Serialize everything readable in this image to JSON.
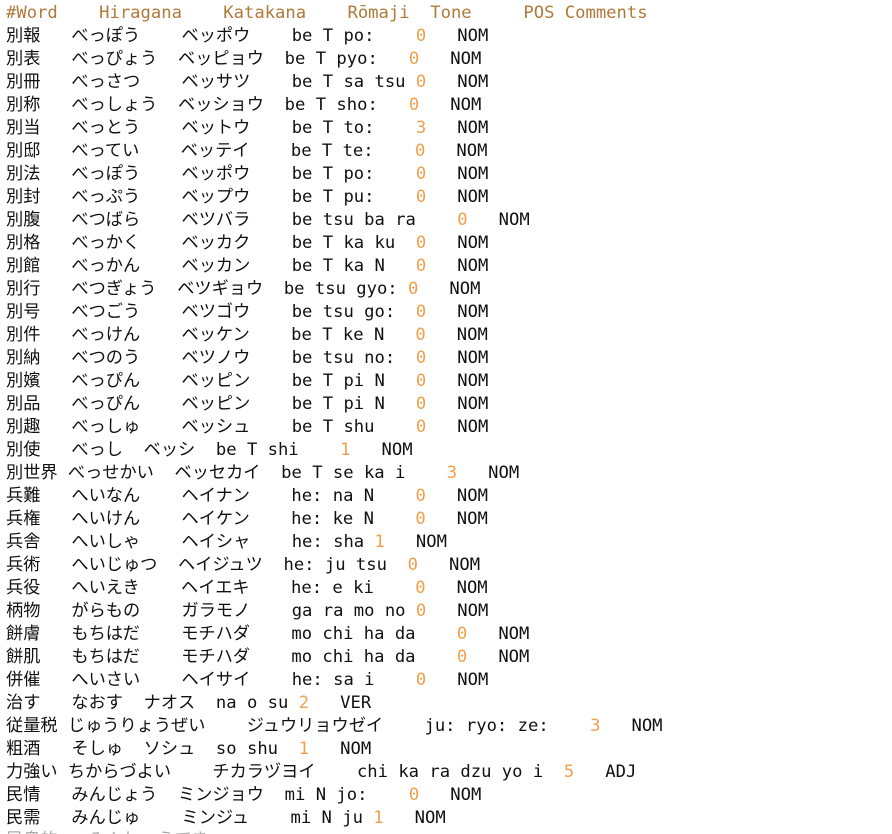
{
  "header": "#Word    Hiragana    Katakana    Rōmaji  Tone     POS Comments",
  "colors": {
    "text": "#111111",
    "header": "#b07a3a",
    "tone": "#f0a04a"
  },
  "rows": [
    {
      "pre": "別報   べっぽう    ベッポウ    be T po:    ",
      "tone": "0",
      "post": "   NOM"
    },
    {
      "pre": "別表   べっぴょう  ベッピョウ  be T pyo:   ",
      "tone": "0",
      "post": "   NOM"
    },
    {
      "pre": "別冊   べっさつ    ベッサツ    be T sa tsu ",
      "tone": "0",
      "post": "   NOM"
    },
    {
      "pre": "別称   べっしょう  ベッショウ  be T sho:   ",
      "tone": "0",
      "post": "   NOM"
    },
    {
      "pre": "別当   べっとう    ベットウ    be T to:    ",
      "tone": "3",
      "post": "   NOM"
    },
    {
      "pre": "別邸   べってい    ベッテイ    be T te:    ",
      "tone": "0",
      "post": "   NOM"
    },
    {
      "pre": "別法   べっぽう    ベッポウ    be T po:    ",
      "tone": "0",
      "post": "   NOM"
    },
    {
      "pre": "別封   べっぷう    ベップウ    be T pu:    ",
      "tone": "0",
      "post": "   NOM"
    },
    {
      "pre": "別腹   べつばら    ベツバラ    be tsu ba ra    ",
      "tone": "0",
      "post": "   NOM"
    },
    {
      "pre": "別格   べっかく    ベッカク    be T ka ku  ",
      "tone": "0",
      "post": "   NOM"
    },
    {
      "pre": "別館   べっかん    ベッカン    be T ka N   ",
      "tone": "0",
      "post": "   NOM"
    },
    {
      "pre": "別行   べつぎょう  ベツギョウ  be tsu gyo: ",
      "tone": "0",
      "post": "   NOM"
    },
    {
      "pre": "別号   べつごう    ベツゴウ    be tsu go:  ",
      "tone": "0",
      "post": "   NOM"
    },
    {
      "pre": "別件   べっけん    ベッケン    be T ke N   ",
      "tone": "0",
      "post": "   NOM"
    },
    {
      "pre": "別納   べつのう    ベツノウ    be tsu no:  ",
      "tone": "0",
      "post": "   NOM"
    },
    {
      "pre": "別嬪   べっぴん    ベッピン    be T pi N   ",
      "tone": "0",
      "post": "   NOM"
    },
    {
      "pre": "別品   べっぴん    ベッピン    be T pi N   ",
      "tone": "0",
      "post": "   NOM"
    },
    {
      "pre": "別趣   べっしゅ    ベッシュ    be T shu    ",
      "tone": "0",
      "post": "   NOM"
    },
    {
      "pre": "別使   べっし  ベッシ  be T shi    ",
      "tone": "1",
      "post": "   NOM"
    },
    {
      "pre": "別世界 べっせかい  ベッセカイ  be T se ka i    ",
      "tone": "3",
      "post": "   NOM"
    },
    {
      "pre": "兵難   へいなん    ヘイナン    he: na N    ",
      "tone": "0",
      "post": "   NOM"
    },
    {
      "pre": "兵権   へいけん    ヘイケン    he: ke N    ",
      "tone": "0",
      "post": "   NOM"
    },
    {
      "pre": "兵舎   へいしゃ    ヘイシャ    he: sha ",
      "tone": "1",
      "post": "   NOM"
    },
    {
      "pre": "兵術   へいじゅつ  ヘイジュツ  he: ju tsu  ",
      "tone": "0",
      "post": "   NOM"
    },
    {
      "pre": "兵役   へいえき    ヘイエキ    he: e ki    ",
      "tone": "0",
      "post": "   NOM"
    },
    {
      "pre": "柄物   がらもの    ガラモノ    ga ra mo no ",
      "tone": "0",
      "post": "   NOM"
    },
    {
      "pre": "餅膚   もちはだ    モチハダ    mo chi ha da    ",
      "tone": "0",
      "post": "   NOM"
    },
    {
      "pre": "餅肌   もちはだ    モチハダ    mo chi ha da    ",
      "tone": "0",
      "post": "   NOM"
    },
    {
      "pre": "併催   へいさい    ヘイサイ    he: sa i    ",
      "tone": "0",
      "post": "   NOM"
    },
    {
      "pre": "治す   なおす  ナオス  na o su ",
      "tone": "2",
      "post": "   VER"
    },
    {
      "pre": "従量税 じゅうりょうぜい    ジュウリョウゼイ    ju: ryo: ze:    ",
      "tone": "3",
      "post": "   NOM"
    },
    {
      "pre": "粗酒   そしゅ  ソシュ  so shu  ",
      "tone": "1",
      "post": "   NOM"
    },
    {
      "pre": "力強い ちからづよい    チカラヅヨイ    chi ka ra dzu yo i  ",
      "tone": "5",
      "post": "   ADJ"
    },
    {
      "pre": "民情   みんじょう  ミンジョウ  mi N jo:    ",
      "tone": "0",
      "post": "   NOM"
    },
    {
      "pre": "民需   みんじゅ    ミンジュ    mi N ju ",
      "tone": "1",
      "post": "   NOM"
    }
  ]
}
